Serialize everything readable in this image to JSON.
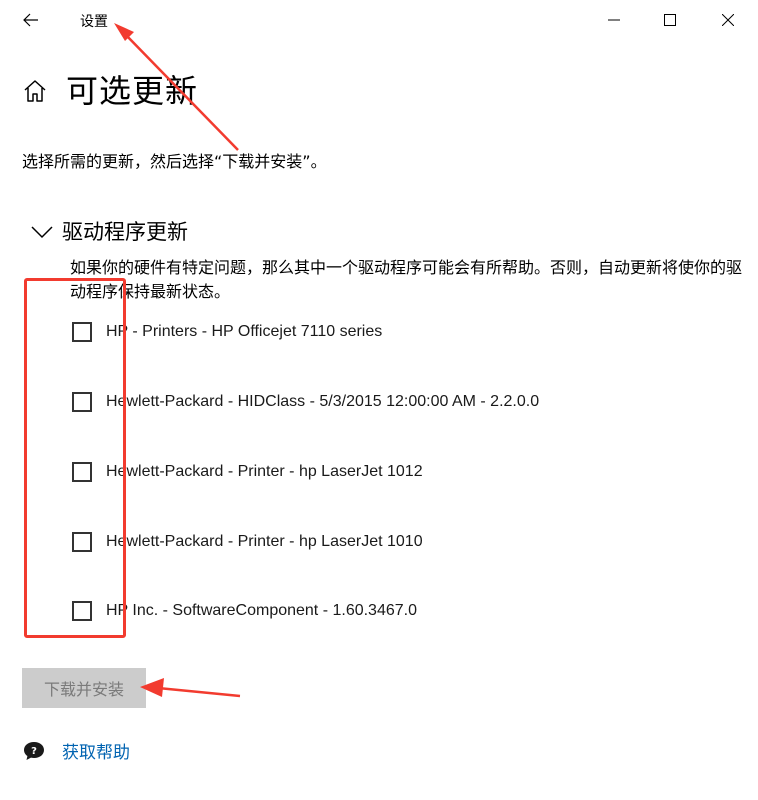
{
  "window": {
    "app_title": "设置",
    "controls": {
      "back": "back-arrow-icon",
      "minimize": "minimize-icon",
      "maximize": "maximize-icon",
      "close": "close-icon"
    }
  },
  "page": {
    "title": "可选更新",
    "home_icon": "home-icon",
    "instructions": "选择所需的更新，然后选择“下载并安装”。"
  },
  "section": {
    "title": "驱动程序更新",
    "expanded": true,
    "description": "如果你的硬件有特定问题，那么其中一个驱动程序可能会有所帮助。否则，自动更新将使你的驱动程序保持最新状态。",
    "items": [
      {
        "label": "HP - Printers - HP Officejet 7110 series",
        "checked": false
      },
      {
        "label": "Hewlett-Packard - HIDClass - 5/3/2015 12:00:00 AM - 2.2.0.0",
        "checked": false
      },
      {
        "label": "Hewlett-Packard  - Printer - hp LaserJet 1012",
        "checked": false
      },
      {
        "label": "Hewlett-Packard  - Printer - hp LaserJet 1010",
        "checked": false
      },
      {
        "label": "HP Inc. - SoftwareComponent - 1.60.3467.0",
        "checked": false
      }
    ]
  },
  "actions": {
    "install_label": "下载并安装",
    "install_enabled": false
  },
  "help": {
    "label": "获取帮助",
    "icon": "help-chat-icon"
  },
  "colors": {
    "accent_link": "#0063b1",
    "annotation": "#f23b2f",
    "disabled_button_bg": "#cccccc",
    "disabled_button_text": "#7a7a7a"
  }
}
